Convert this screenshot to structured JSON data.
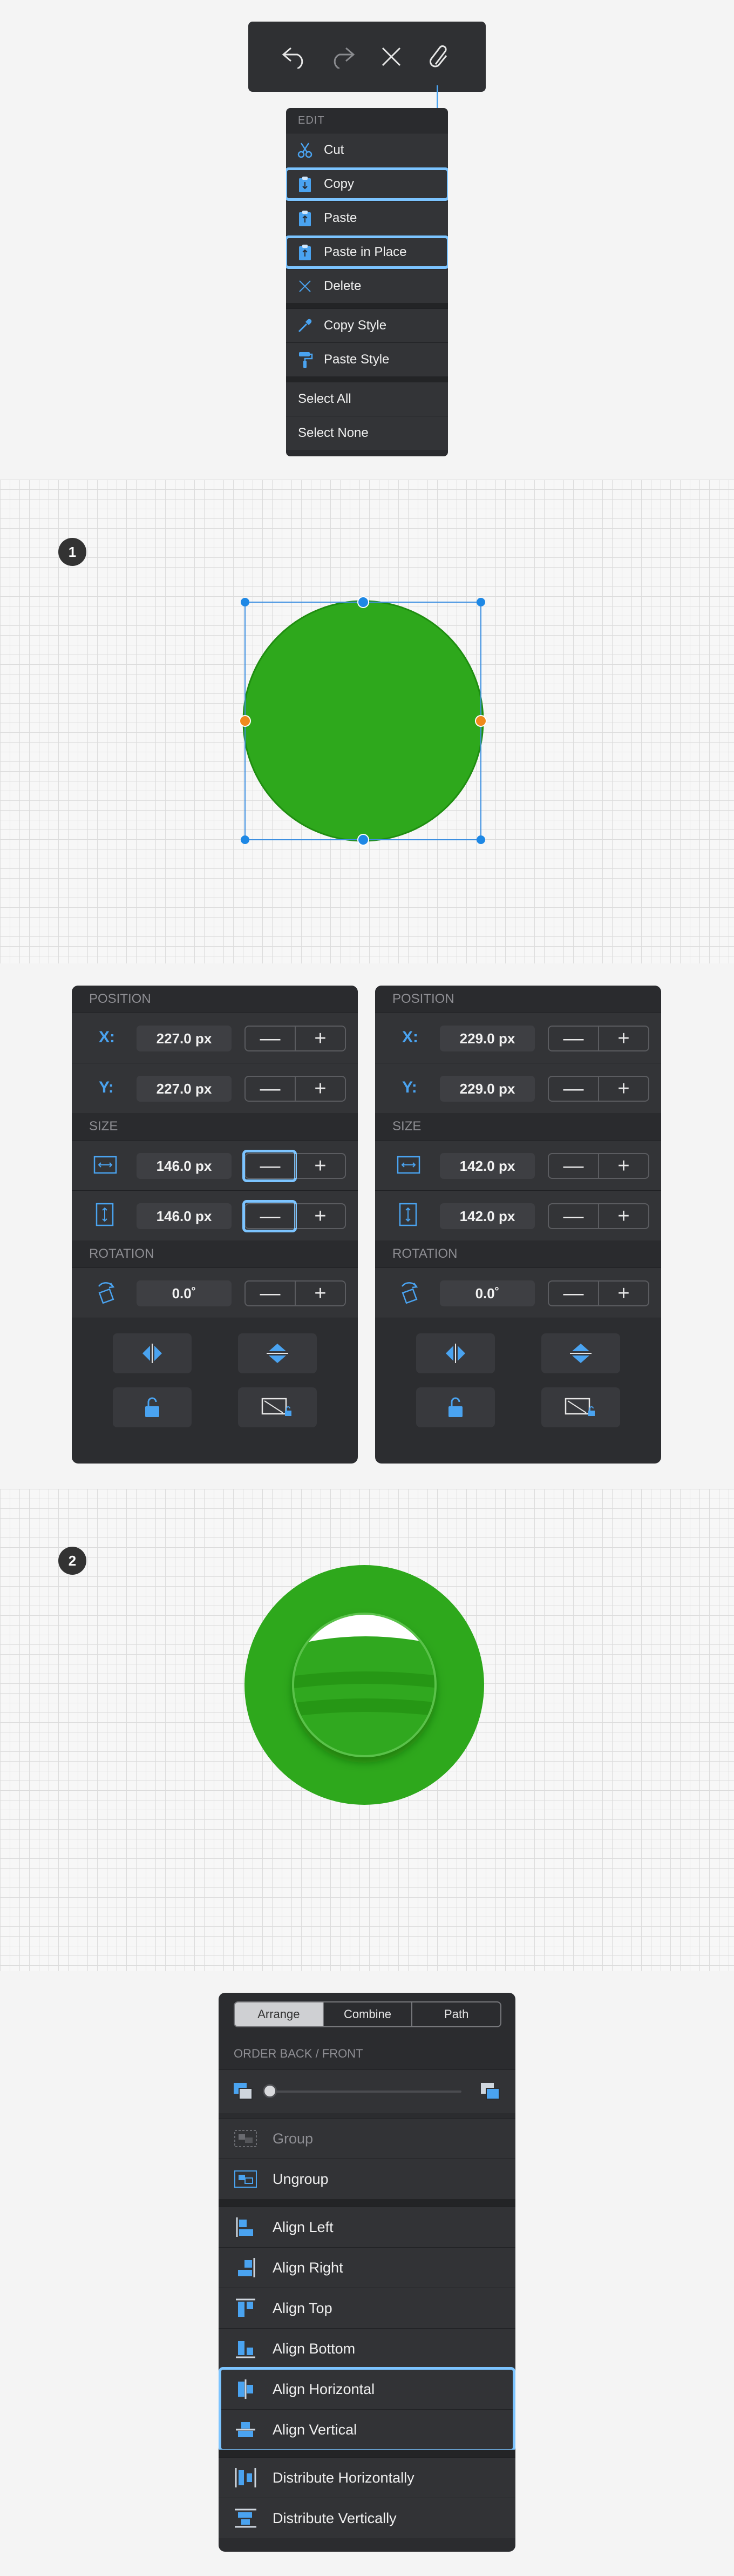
{
  "edit_menu": {
    "header": "EDIT",
    "items": [
      {
        "label": "Cut",
        "icon": "scissors-icon"
      },
      {
        "label": "Copy",
        "icon": "clipboard-icon"
      },
      {
        "label": "Paste",
        "icon": "clipboard-icon"
      },
      {
        "label": "Paste in Place",
        "icon": "clipboard-icon"
      },
      {
        "label": "Delete",
        "icon": "x-icon"
      },
      {
        "label": "Copy Style",
        "icon": "eyedropper-icon"
      },
      {
        "label": "Paste Style",
        "icon": "paint-roller-icon"
      },
      {
        "label": "Select All"
      },
      {
        "label": "Select None"
      }
    ]
  },
  "steps": {
    "one": "1",
    "two": "2"
  },
  "panels": [
    {
      "position_title": "POSITION",
      "x_label": "X:",
      "x_value": "227.0 px",
      "y_label": "Y:",
      "y_value": "227.0 px",
      "size_title": "SIZE",
      "width_value": "146.0 px",
      "height_value": "146.0 px",
      "rotation_title": "ROTATION",
      "rotation_value": "0.0˚"
    },
    {
      "position_title": "POSITION",
      "x_label": "X:",
      "x_value": "229.0 px",
      "y_label": "Y:",
      "y_value": "229.0 px",
      "size_title": "SIZE",
      "width_value": "142.0 px",
      "height_value": "142.0 px",
      "rotation_title": "ROTATION",
      "rotation_value": "0.0˚"
    }
  ],
  "stepper": {
    "minus": "—",
    "plus": "+"
  },
  "arrange": {
    "tabs": [
      "Arrange",
      "Combine",
      "Path"
    ],
    "order_title": "ORDER BACK / FRONT",
    "order_level": 0,
    "group": "Group",
    "ungroup": "Ungroup",
    "align_left": "Align Left",
    "align_right": "Align Right",
    "align_top": "Align Top",
    "align_bottom": "Align Bottom",
    "align_horizontal": "Align Horizontal",
    "align_vertical": "Align Vertical",
    "distribute_horizontally": "Distribute Horizontally",
    "distribute_vertically": "Distribute Vertically"
  },
  "colors": {
    "accent": "#4aa3f0",
    "highlight": "#7cc4ff",
    "green": "#2ea81c",
    "handle_orange": "#f08a1c"
  }
}
